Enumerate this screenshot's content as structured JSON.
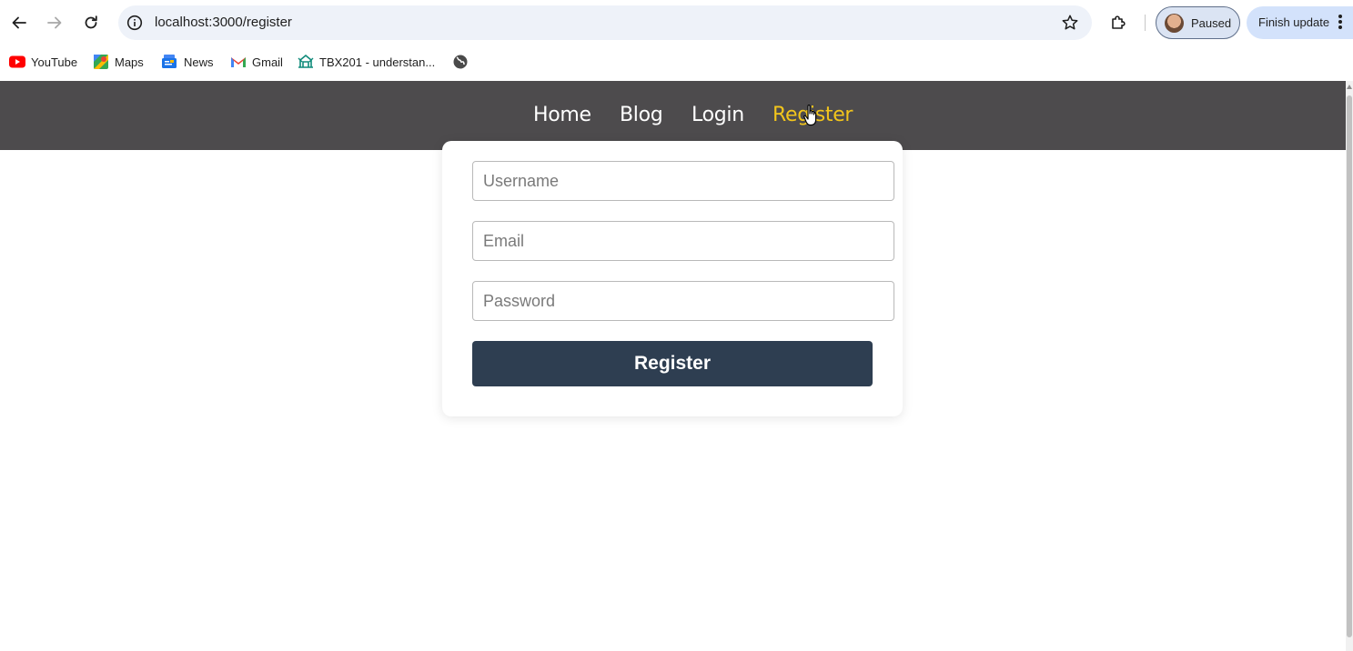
{
  "browser": {
    "url": "localhost:3000/register",
    "profile_label": "Paused",
    "update_label": "Finish update",
    "icons": {
      "back": "back-arrow-icon",
      "forward": "forward-arrow-icon",
      "reload": "reload-icon",
      "info": "info-icon",
      "star": "bookmark-star-icon",
      "extensions": "puzzle-icon",
      "menu": "kebab-menu-icon"
    }
  },
  "bookmarks": [
    {
      "label": "YouTube",
      "icon": "youtube-icon"
    },
    {
      "label": "Maps",
      "icon": "maps-icon"
    },
    {
      "label": "News",
      "icon": "news-icon"
    },
    {
      "label": "Gmail",
      "icon": "gmail-icon"
    },
    {
      "label": "TBX201 - understan...",
      "icon": "tbx-icon"
    },
    {
      "label": "",
      "icon": "globe-icon"
    }
  ],
  "site_nav": {
    "links": [
      {
        "label": "Home",
        "active": false
      },
      {
        "label": "Blog",
        "active": false
      },
      {
        "label": "Login",
        "active": false
      },
      {
        "label": "Register",
        "active": true
      }
    ],
    "background": "#4d4b4d",
    "active_color": "#f2c51c"
  },
  "form": {
    "username_placeholder": "Username",
    "email_placeholder": "Email",
    "password_placeholder": "Password",
    "submit_label": "Register",
    "button_color": "#2e3e51"
  }
}
